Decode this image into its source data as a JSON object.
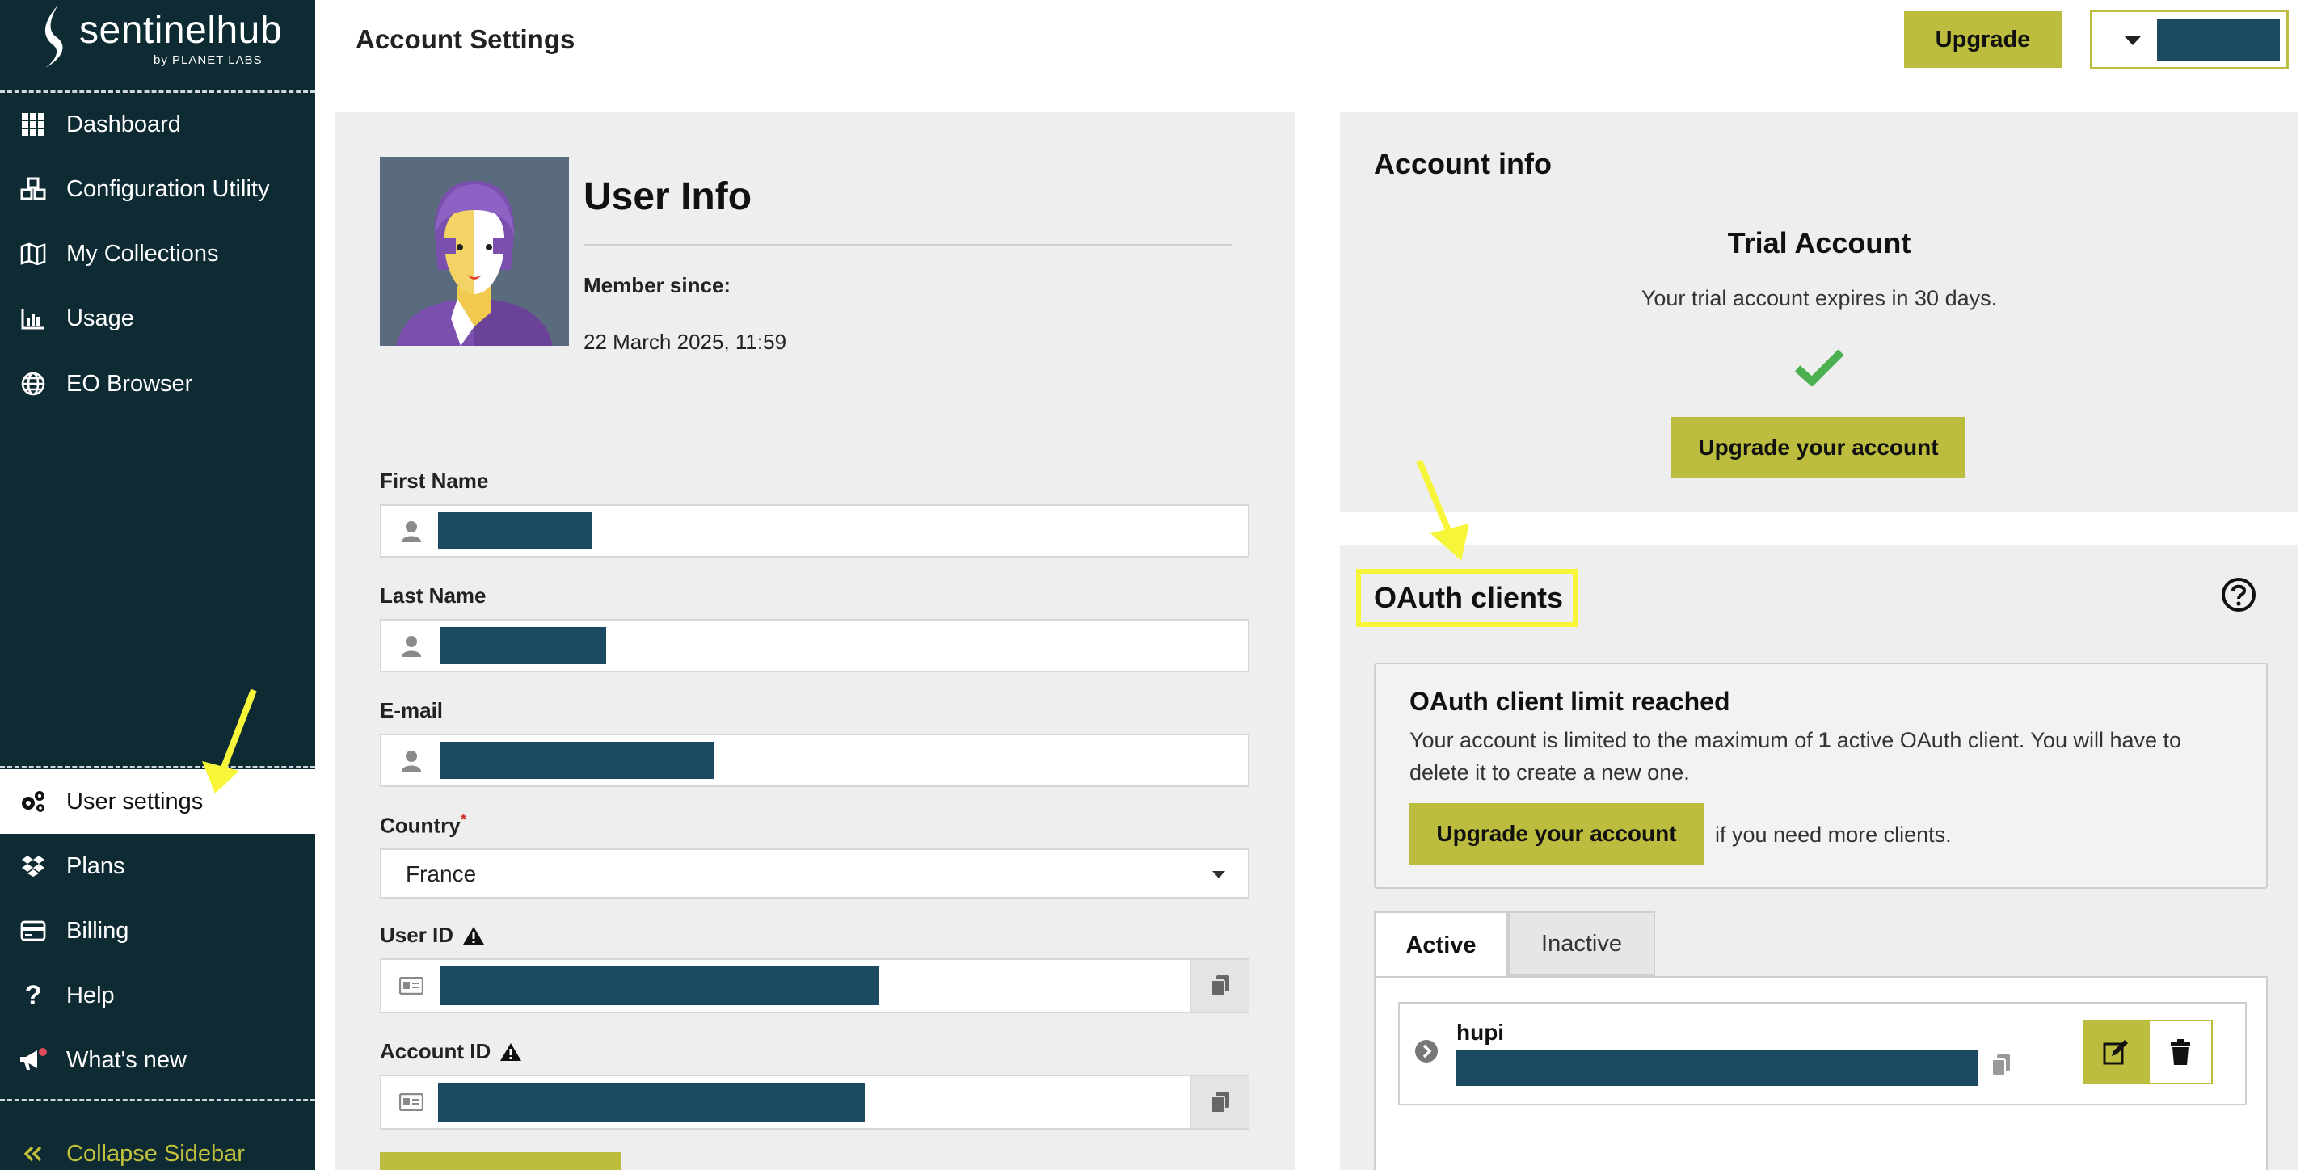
{
  "sidebar": {
    "logo_name": "sentinelhub",
    "logo_sub": "by PLANET LABS",
    "items": [
      {
        "label": "Dashboard",
        "icon": "grid-icon"
      },
      {
        "label": "Configuration Utility",
        "icon": "cubes-icon"
      },
      {
        "label": "My Collections",
        "icon": "map-icon"
      },
      {
        "label": "Usage",
        "icon": "bar-chart-icon"
      },
      {
        "label": "EO Browser",
        "icon": "globe-icon"
      },
      {
        "label": "User settings",
        "icon": "gears-icon",
        "active": true
      },
      {
        "label": "Plans",
        "icon": "dropbox-icon"
      },
      {
        "label": "Billing",
        "icon": "credit-card-icon"
      },
      {
        "label": "Help",
        "icon": "question-icon"
      },
      {
        "label": "What's new",
        "icon": "megaphone-icon"
      }
    ],
    "collapse_label": "Collapse Sidebar"
  },
  "header": {
    "title": "Account Settings",
    "upgrade_label": "Upgrade"
  },
  "user_info": {
    "title": "User Info",
    "member_since_label": "Member since:",
    "member_since_value": "22 March 2025, 11:59",
    "first_name_label": "First Name",
    "last_name_label": "Last Name",
    "email_label": "E-mail",
    "country_label": "Country",
    "country_required": "*",
    "country_value": "France",
    "user_id_label": "User ID",
    "account_id_label": "Account ID"
  },
  "account_info": {
    "title": "Account info",
    "plan": "Trial Account",
    "expiry_text": "Your trial account expires in 30 days.",
    "upgrade_label": "Upgrade your account"
  },
  "oauth": {
    "title": "OAuth clients",
    "limit_title": "OAuth client limit reached",
    "limit_text_pre": "Your account is limited to the maximum of ",
    "limit_count": "1",
    "limit_text_post": " active OAuth client. You will have to delete it to create a new one.",
    "upgrade_label": "Upgrade your account",
    "upgrade_suffix": "if you need more clients.",
    "tabs": [
      "Active",
      "Inactive"
    ],
    "clients": [
      {
        "name": "hupi"
      }
    ]
  },
  "colors": {
    "sidebar_bg": "#0e2a33",
    "accent_olive": "#bcbc3e",
    "redaction": "#1d4a63",
    "annotation_yellow": "#f7f53a",
    "success_green": "#4caf50"
  }
}
